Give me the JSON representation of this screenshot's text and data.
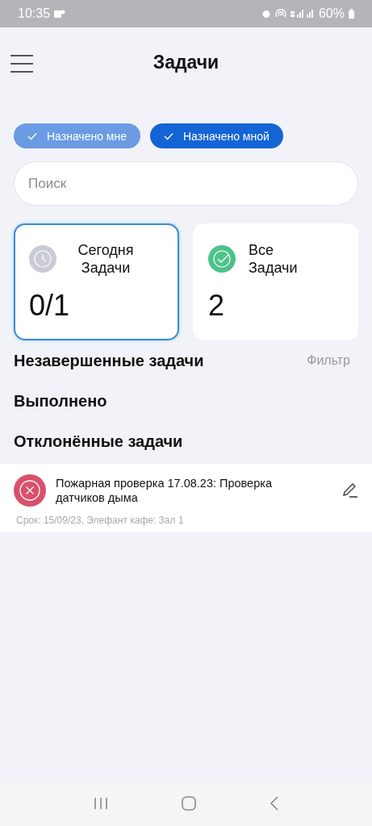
{
  "status_bar": {
    "time": "10:35",
    "battery": "60%"
  },
  "header": {
    "title": "Задачи"
  },
  "filters": [
    {
      "label": "Назначено мне",
      "selected": false
    },
    {
      "label": "Назначено мной",
      "selected": true
    }
  ],
  "search": {
    "placeholder": "Поиск"
  },
  "cards": [
    {
      "kind": "today",
      "title": "Сегодня Задачи",
      "value": "0/1",
      "selected": true
    },
    {
      "kind": "all",
      "title": "Все Задачи",
      "value": "2",
      "selected": false
    }
  ],
  "sections": [
    {
      "title": "Незавершенные задачи",
      "action": "Фильтр"
    },
    {
      "title": "Выполнено"
    },
    {
      "title": "Отклонённые задачи"
    }
  ],
  "tasks": [
    {
      "kind": "rejected",
      "title": "Пожарная проверка 17.08.23: Проверка датчиков дыма",
      "meta": "Срок: 15/09/23, Элефант кафе: Зал 1"
    }
  ]
}
